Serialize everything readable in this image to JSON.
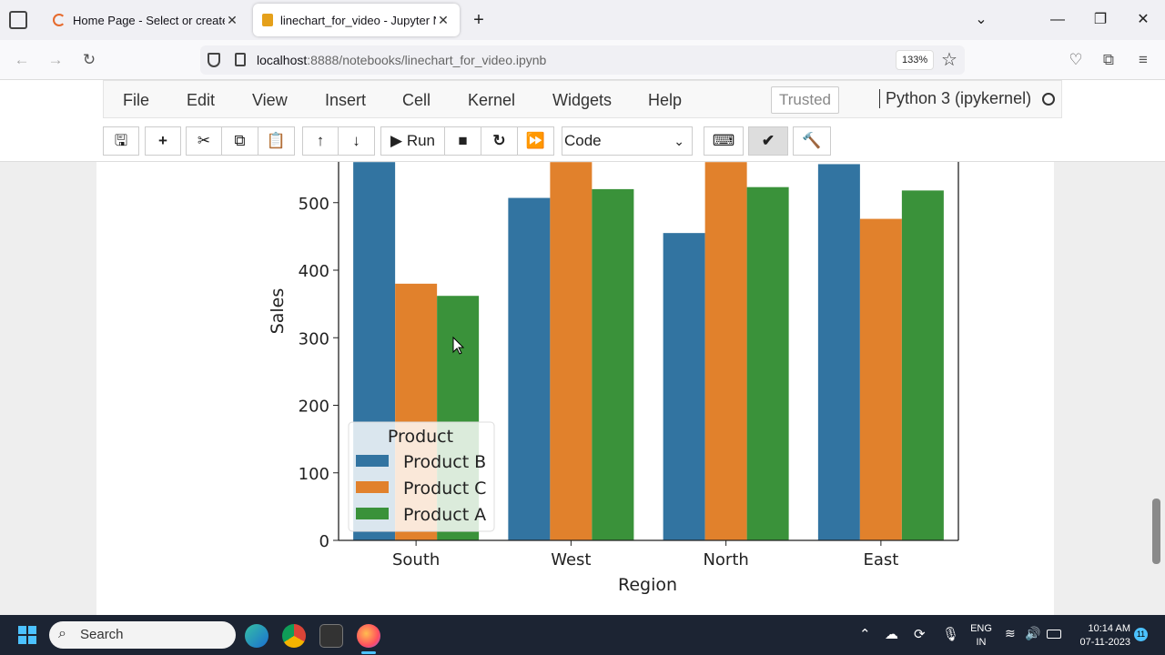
{
  "browser": {
    "tabs": [
      {
        "title": "Home Page - Select or create a",
        "active": false
      },
      {
        "title": "linechart_for_video - Jupyter No",
        "active": true
      }
    ],
    "new_tab_icon": "plus-icon",
    "url_host": "localhost",
    "url_rest": ":8888/notebooks/linechart_for_video.ipynb",
    "zoom": "133%"
  },
  "jupyter": {
    "menu": [
      "File",
      "Edit",
      "View",
      "Insert",
      "Cell",
      "Kernel",
      "Widgets",
      "Help"
    ],
    "trusted": "Trusted",
    "kernel": "Python 3 (ipykernel)",
    "run_label": "Run",
    "cell_type": "Code"
  },
  "chart_data": {
    "type": "bar",
    "categories": [
      "South",
      "West",
      "North",
      "East"
    ],
    "series": [
      {
        "name": "Product B",
        "color": "#3274a1",
        "values": [
          560,
          507,
          455,
          557
        ]
      },
      {
        "name": "Product C",
        "color": "#e1812c",
        "values": [
          380,
          560,
          560,
          476
        ]
      },
      {
        "name": "Product A",
        "color": "#3a923a",
        "values": [
          362,
          520,
          523,
          518
        ]
      }
    ],
    "xlabel": "Region",
    "ylabel": "Sales",
    "yticks": [
      "0",
      "100",
      "200",
      "300",
      "400",
      "500"
    ],
    "ylim": [
      0,
      560
    ],
    "legend_title": "Product",
    "legend_position": "lower-left"
  },
  "taskbar": {
    "search_label": "Search",
    "lang_top": "ENG",
    "lang_bottom": "IN",
    "time": "10:14 AM",
    "date": "07-11-2023",
    "notifications": "11"
  }
}
